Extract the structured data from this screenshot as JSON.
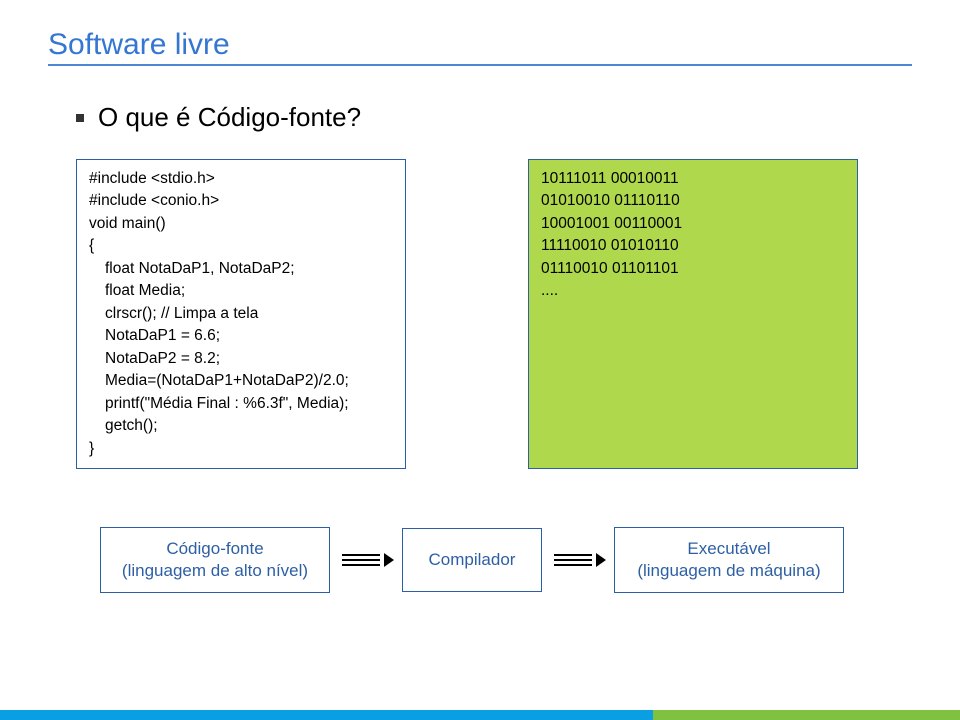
{
  "title": "Software livre",
  "bullet_text": "O que é Código-fonte?",
  "code": {
    "l1": "#include <stdio.h>",
    "l2": "#include <conio.h>",
    "l3": "void main()",
    "l4": "{",
    "l5": "float NotaDaP1, NotaDaP2;",
    "l6": "float Media;",
    "l7": "clrscr(); // Limpa a tela",
    "l8": "NotaDaP1 = 6.6;",
    "l9": "NotaDaP2 = 8.2;",
    "l10": "Media=(NotaDaP1+NotaDaP2)/2.0;",
    "l11": "printf(\"Média Final : %6.3f\", Media);",
    "l12": "getch();",
    "l13": "}"
  },
  "binary": {
    "b1": "10111011 00010011",
    "b2": "01010010 01110110",
    "b3": "10001001 00110001",
    "b4": "11110010 01010110",
    "b5": "01110010 01101101",
    "b6": "...."
  },
  "labels": {
    "source": {
      "line1": "Código-fonte",
      "line2": "(linguagem de alto nível)"
    },
    "compiler": "Compilador",
    "exec": {
      "line1": "Executável",
      "line2": "(linguagem de máquina)"
    }
  }
}
